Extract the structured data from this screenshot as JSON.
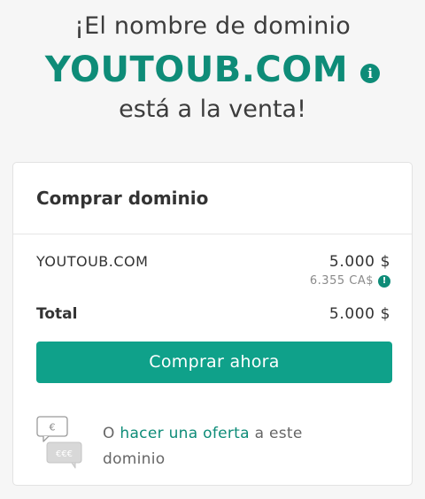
{
  "hero": {
    "line1": "¡El nombre de dominio",
    "domain": "YOUTOUB.COM",
    "line3": "está a la venta!"
  },
  "card": {
    "title": "Comprar dominio",
    "item_name": "YOUTOUB.COM",
    "price": "5.000 $",
    "converted_price": "6.355 CA$",
    "total_label": "Total",
    "total_value": "5.000 $",
    "buy_button": "Comprar ahora",
    "offer_prefix": "O ",
    "offer_link": "hacer una oferta",
    "offer_suffix": " a este dominio"
  },
  "colors": {
    "accent": "#0e8c78",
    "button": "#0fa18a"
  }
}
